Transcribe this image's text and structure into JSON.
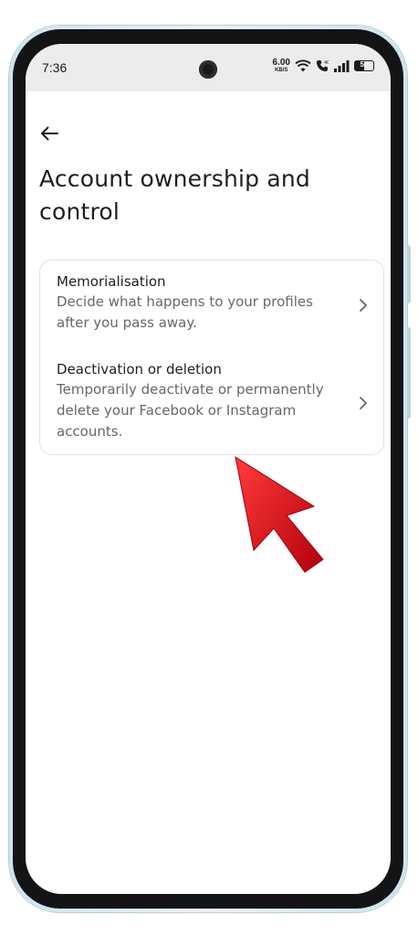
{
  "status_bar": {
    "time": "7:36",
    "net_speed_value": "6.00",
    "net_speed_unit": "KB/S",
    "battery": "50",
    "icons": [
      "wifi-icon",
      "call-icon",
      "signal-icon",
      "battery-icon"
    ]
  },
  "header": {
    "back_icon": "arrow-left-icon",
    "title": "Account ownership and control"
  },
  "options": [
    {
      "title": "Memorialisation",
      "description": "Decide what happens to your profiles after you pass away."
    },
    {
      "title": "Deactivation or deletion",
      "description": "Temporarily deactivate or permanently delete your Facebook or Instagram accounts."
    }
  ],
  "annotation": {
    "icon": "red-pointer-arrow-icon",
    "color": "#e01b24"
  },
  "colors": {
    "title": "#1c1e21",
    "secondary_text": "#65676b",
    "card_border": "#dfe1e5"
  }
}
